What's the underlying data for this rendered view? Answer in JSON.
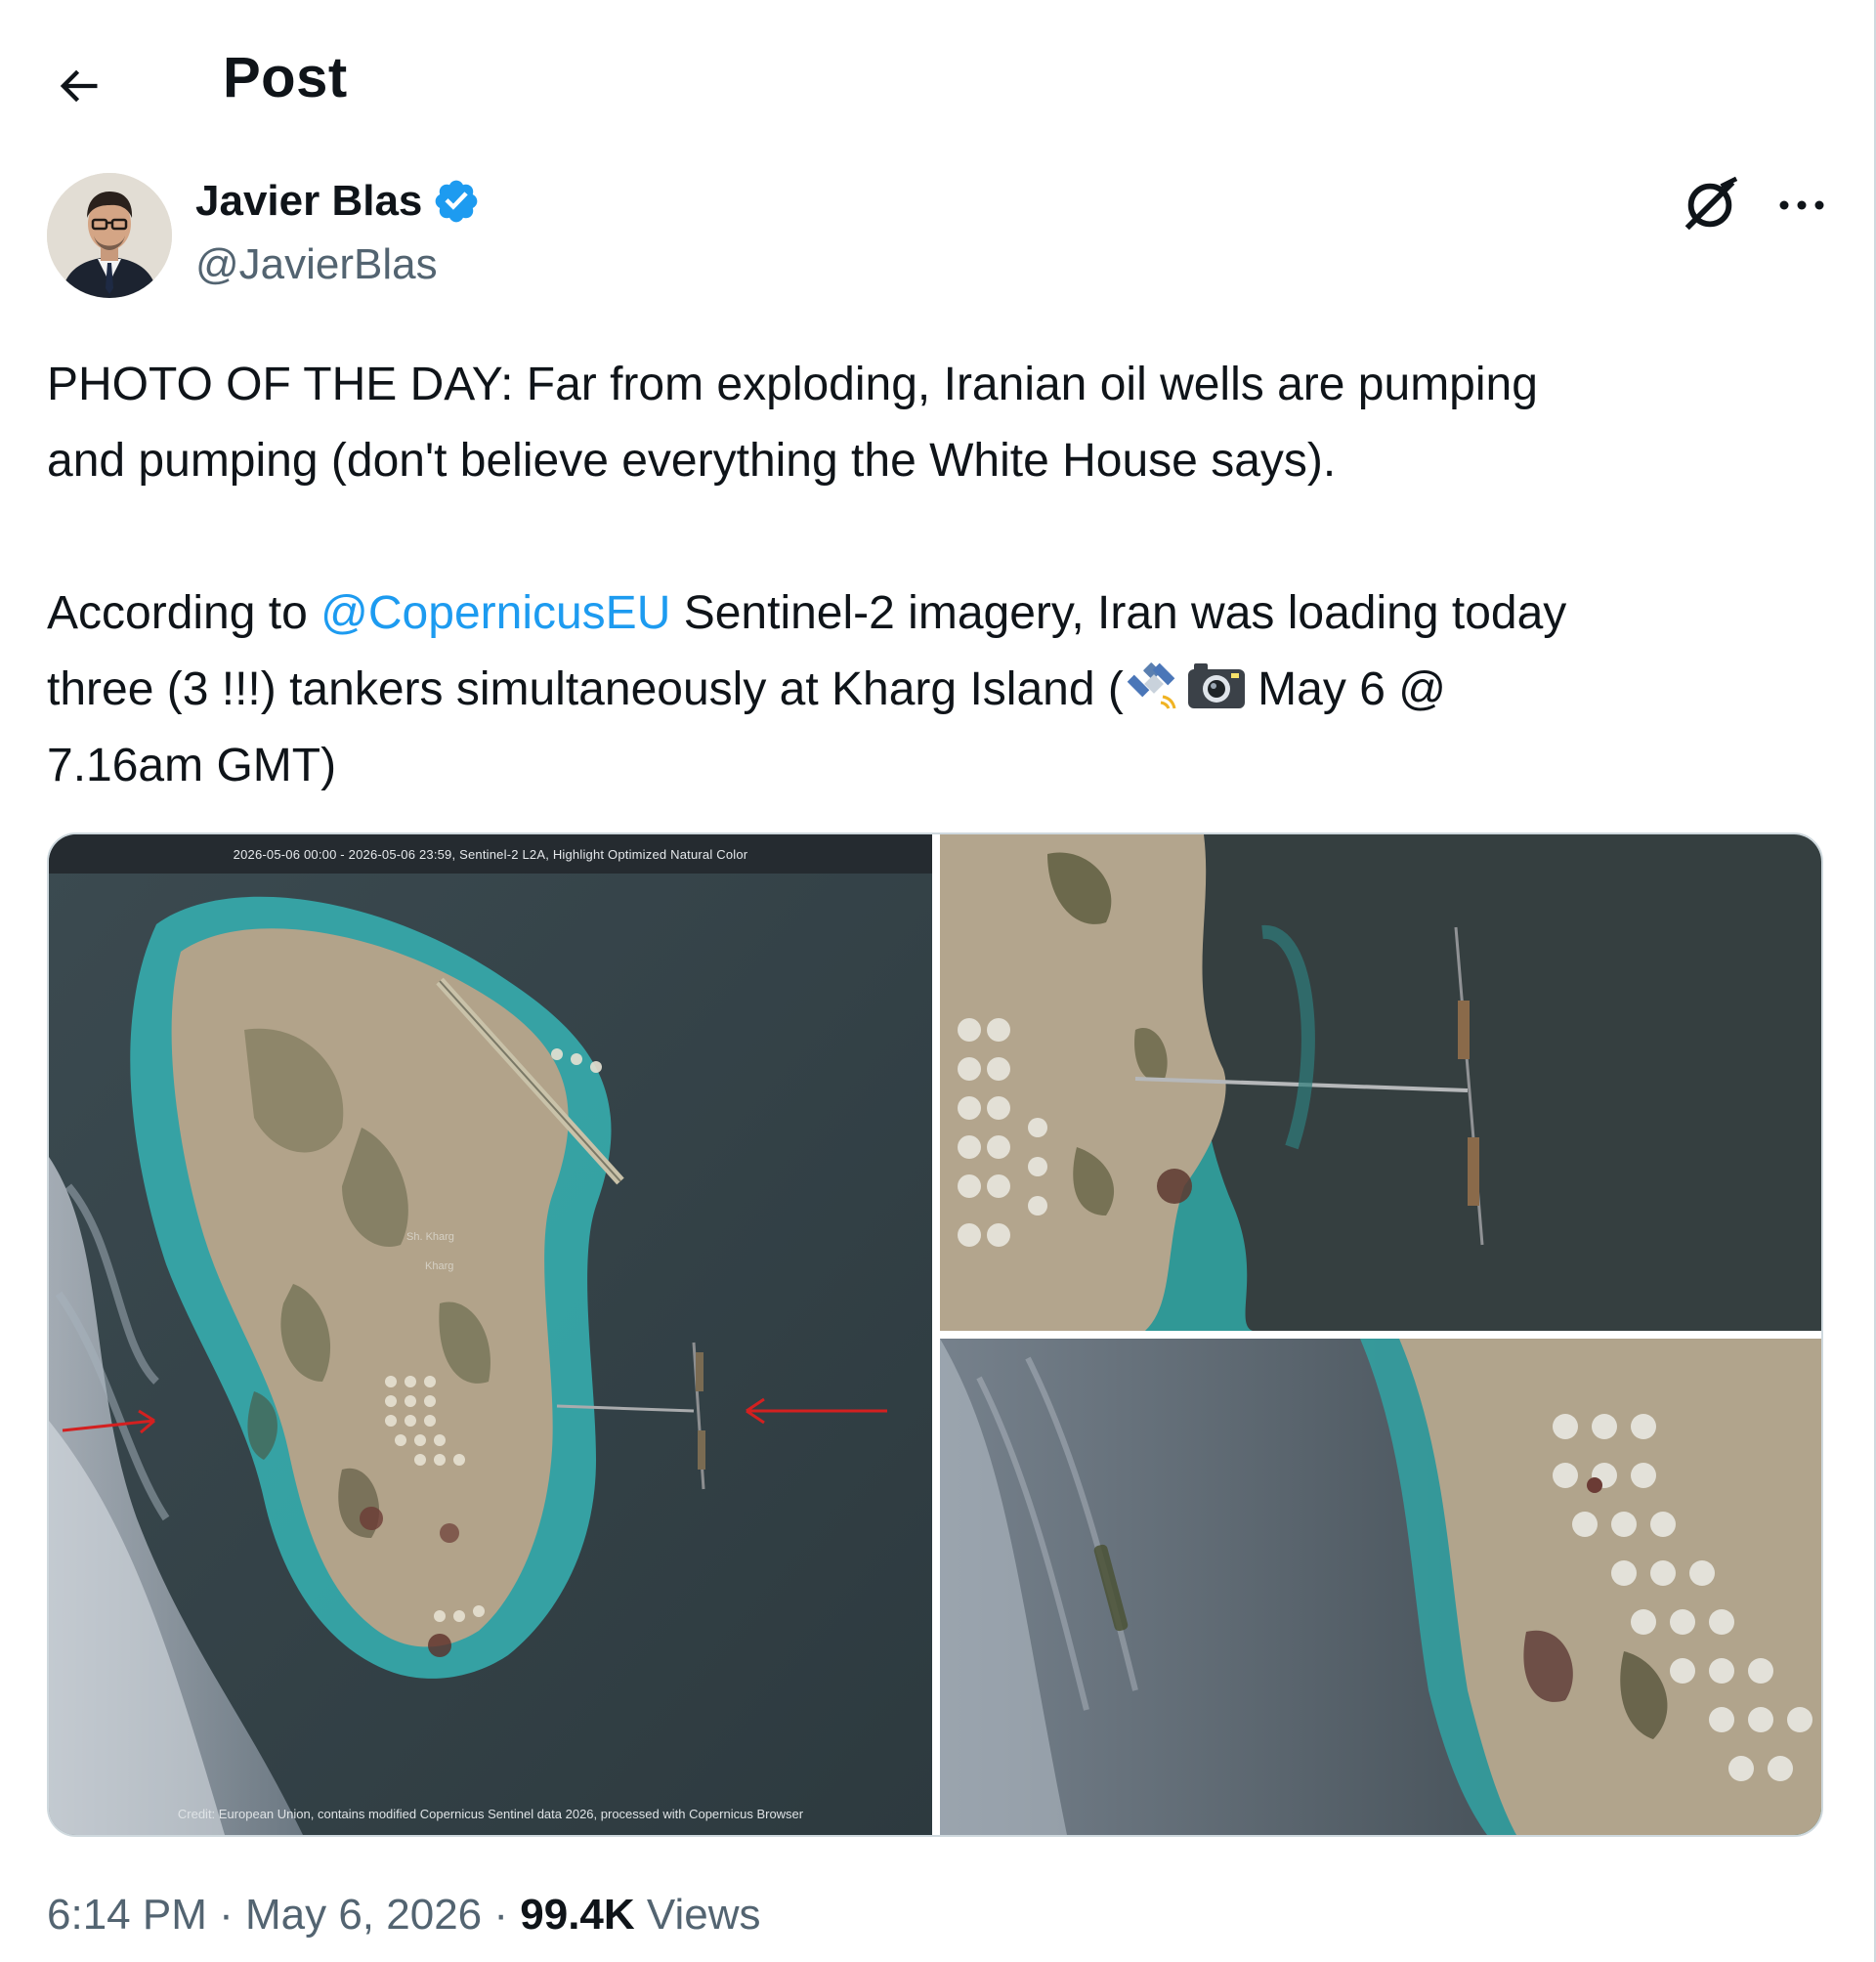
{
  "header": {
    "title": "Post",
    "back_icon": "arrow-left-icon"
  },
  "author": {
    "name": "Javier Blas",
    "handle": "@JavierBlas",
    "verified_color": "#1d9bf0"
  },
  "tweet": {
    "line1": "PHOTO OF THE DAY: Far from exploding, Iranian oil wells are pumping",
    "line2": "and pumping (don't believe everything the White House says).",
    "p2_before": "According to ",
    "mention": "@CopernicusEU",
    "p2_after_a": " Sentinel-2 imagery, Iran was loading today",
    "p2_line2": "three (3 !!!) tankers simultaneously at Kharg Island (",
    "p2_line2_tail": " May 6 @",
    "p2_line3": "7.16am GMT)",
    "emojis": [
      "satellite-emoji",
      "camera-flash-emoji"
    ]
  },
  "media": {
    "main_caption": "2026-05-06 00:00 - 2026-05-06 23:59, Sentinel-2 L2A, Highlight Optimized Natural Color",
    "credit": "Credit: European Union, contains modified Copernicus Sentinel data 2026, processed with Copernicus Browser",
    "map_label_town": "Sh. Kharg",
    "map_label_island": "Kharg",
    "arrow_color": "#d32020"
  },
  "meta": {
    "time": "6:14 PM",
    "separator": " · ",
    "date": "May 6, 2026",
    "views_count": "99.4K",
    "views_label": " Views"
  },
  "colors": {
    "link": "#1d9bf0",
    "secondary": "#536471",
    "text": "#0f1419"
  }
}
